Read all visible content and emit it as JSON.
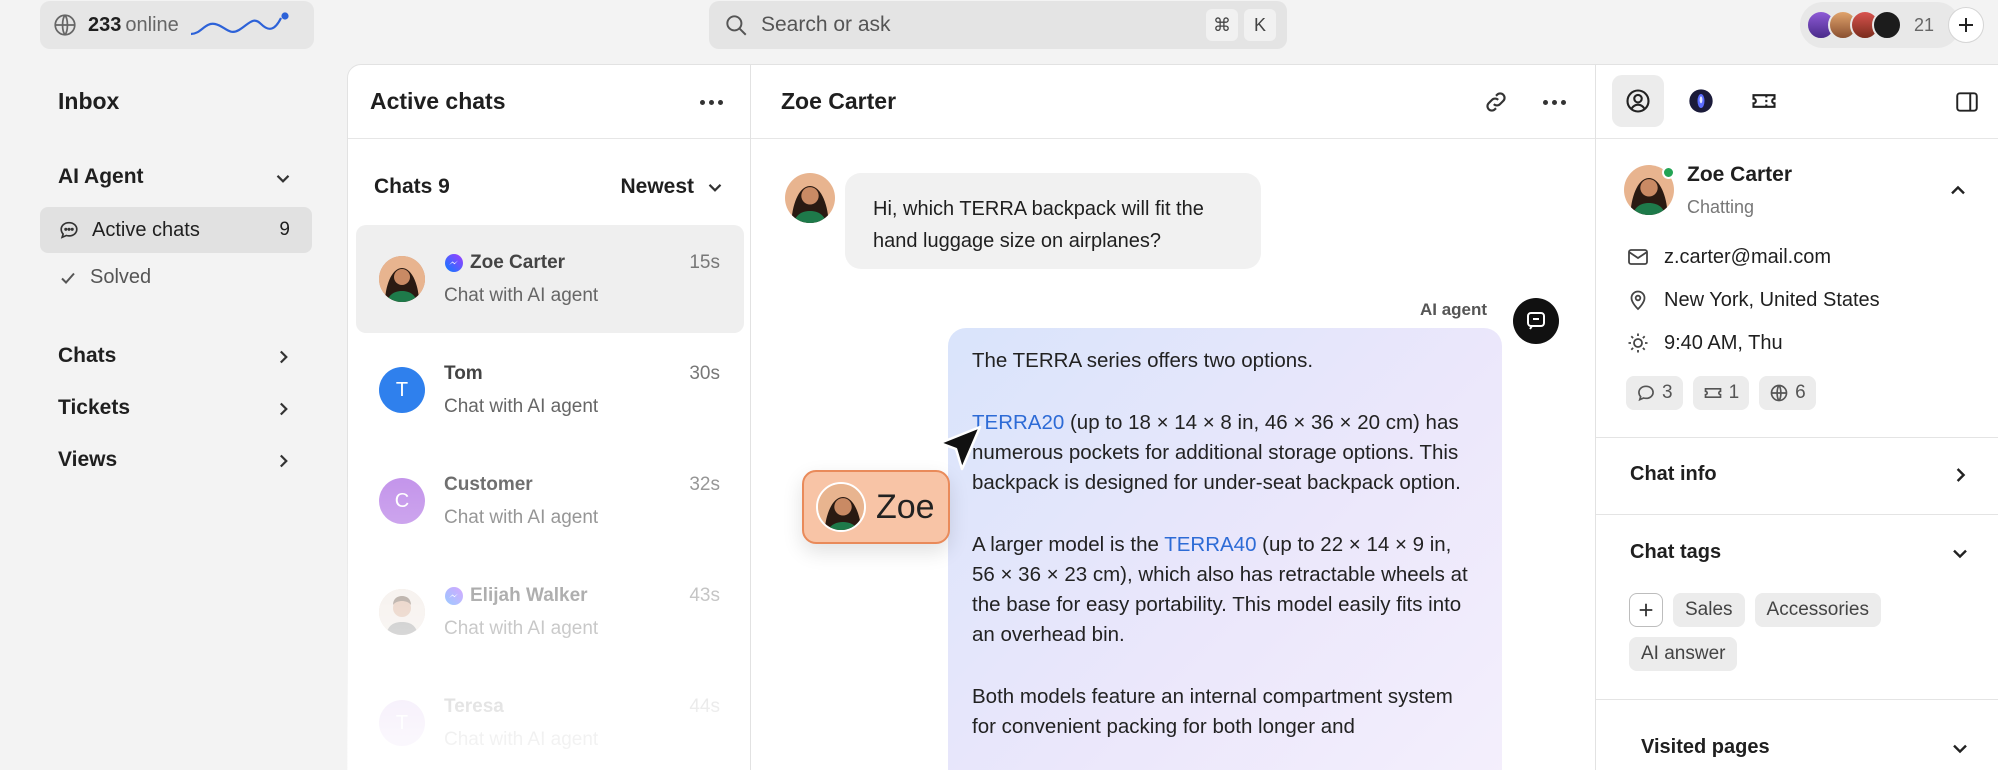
{
  "topbar": {
    "online_count": "233",
    "online_label": "online",
    "search_placeholder": "Search or ask",
    "shortcut_cmd": "⌘",
    "shortcut_key": "K",
    "team_count": "21"
  },
  "nav": {
    "title": "Inbox",
    "ai_agent": "AI Agent",
    "active_chats": "Active chats",
    "active_count": "9",
    "solved": "Solved",
    "chats": "Chats",
    "tickets": "Tickets",
    "views": "Views"
  },
  "chat_list": {
    "title": "Active chats",
    "count_label": "Chats 9",
    "sort_label": "Newest",
    "items": [
      {
        "name": "Zoe Carter",
        "time": "15s",
        "subtitle": "Chat with AI agent",
        "initial": "",
        "color": "#c78a6b",
        "messenger": true
      },
      {
        "name": "Tom",
        "time": "30s",
        "subtitle": "Chat with AI agent",
        "initial": "T",
        "color": "#2f80ed",
        "messenger": false
      },
      {
        "name": "Customer",
        "time": "32s",
        "subtitle": "Chat with AI agent",
        "initial": "C",
        "color": "#b478e6",
        "messenger": false
      },
      {
        "name": "Elijah Walker",
        "time": "43s",
        "subtitle": "Chat with AI agent",
        "initial": "",
        "color": "#d9b9a5",
        "messenger": true
      },
      {
        "name": "Teresa",
        "time": "44s",
        "subtitle": "Chat with AI agent",
        "initial": "T",
        "color": "#c9a3e8",
        "messenger": false
      }
    ]
  },
  "conversation": {
    "title": "Zoe Carter",
    "customer_message": "Hi, which TERRA backpack will fit the hand luggage size on airplanes?",
    "ai_label": "AI agent",
    "ai_p1": "The TERRA series offers two options.",
    "ai_p2_link": "TERRA20",
    "ai_p2_rest": " (up to 18 × 14 × 8 in, 46 × 36 × 20 cm) has numerous pockets for additional storage options. This backpack is designed for under-seat backpack option.",
    "ai_p3_pre": "A larger model is the ",
    "ai_p3_link": "TERRA40",
    "ai_p3_rest": " (up to 22 × 14 × 9 in, 56 × 36 × 23 cm), which also has retractable wheels at the base for easy portability. This model easily fits into an overhead bin.",
    "ai_p4": "Both models feature an internal compartment system for convenient packing for both longer and",
    "cursor_tag": "Zoe"
  },
  "details": {
    "name": "Zoe Carter",
    "status": "Chatting",
    "email": "z.carter@mail.com",
    "location": "New York, United States",
    "local_time": "9:40 AM, Thu",
    "chats_count": "3",
    "tickets_count": "1",
    "visits_count": "6",
    "chat_info": "Chat info",
    "chat_tags": "Chat tags",
    "tags": [
      "Sales",
      "Accessories",
      "AI answer"
    ],
    "visited_pages": "Visited pages"
  }
}
